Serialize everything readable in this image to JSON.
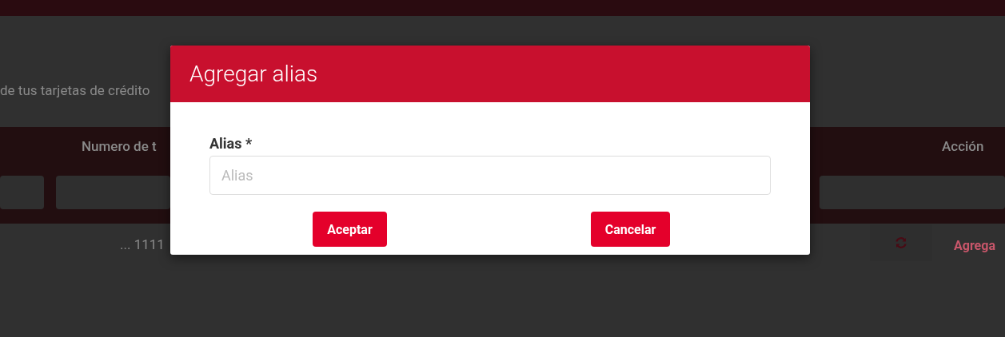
{
  "page": {
    "intro_text": "de tus tarjetas de crédito",
    "table": {
      "columns": [
        "Numero de t",
        "Acción"
      ],
      "rows": [
        {
          "card_number": "... 1111",
          "action": "Agrega"
        }
      ]
    }
  },
  "dialog": {
    "title": "Agregar alias",
    "field": {
      "label": "Alias *",
      "placeholder": "Alias"
    },
    "buttons": [
      "Aceptar",
      "Cancelar"
    ]
  }
}
